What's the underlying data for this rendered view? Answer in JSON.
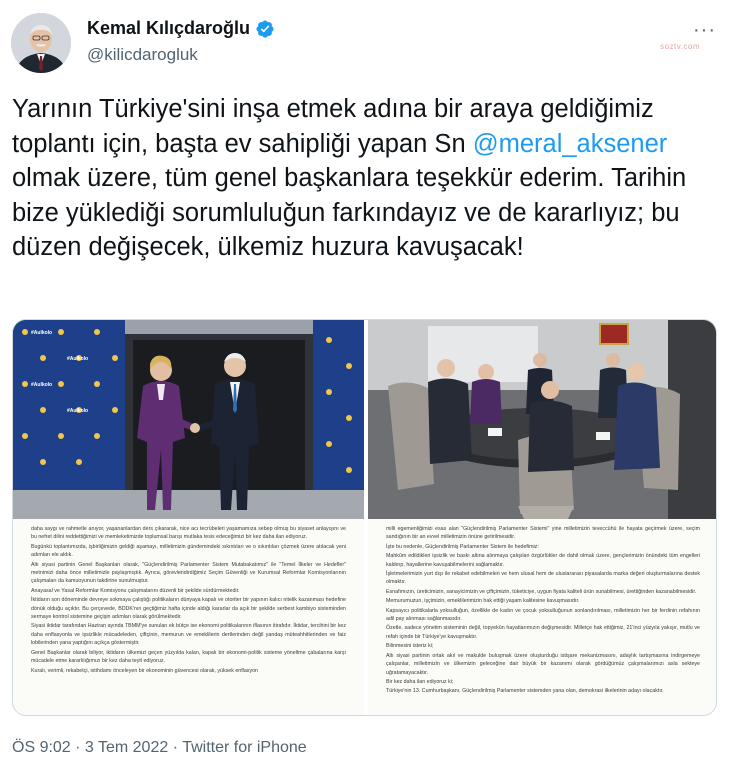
{
  "author": {
    "name": "Kemal Kılıçdaroğlu",
    "handle": "@kilicdarogluk",
    "verified": true
  },
  "watermark": "soztv.com",
  "tweet": {
    "text_before": "Yarının Türkiye'sini inşa etmek adına bir araya geldiğimiz toplantı için, başta ev sahipliği yapan Sn ",
    "mention": "@meral_aksener",
    "text_after": " olmak üzere, tüm genel başkanlara teşekkür ederim. Tarihin bize yüklediği sorumluluğun farkındayız ve de kararlıyız; bu düzen değişecek, ülkemiz huzura kavuşacak!"
  },
  "media": {
    "photo_left": {
      "backdrop_text": "#Aulkolo"
    },
    "doc_left": [
      "daha saygı ve rahmetle anıyor, yaşananlardan ders çıkararak, nice acı tecrübeleri yaşamamıza sebep olmuş bu siyaset anlayışını ve bu nefret dilini reddettiğimizi ve memleketimizde toplumsal barışı mutlaka tesis edeceğimizi bir kez daha ilan ediyoruz.",
      "Bugünkü toplantımızda, işbirliğimizin geldiği aşamayı, milletimizin gündemindeki sıkıntıları ve o sıkıntıları çözmek üzere atılacak yeni adımları ele aldık.",
      "Altı siyasi partinin Genel Başkanları olarak, \"Güçlendirilmiş Parlamenter Sistem Mutabakatımız\" ile \"Temel İlkeler ve Hedefler\" metnimizi daha önce milletimizle paylaşmıştık. Ayrıca, görevlendirdiğimiz Seçim Güvenliği ve Kurumsal Reformlar Komisyonlarının çalışmaları da kamuoyunun takdirine sunulmuştur.",
      "Anayasal ve Yasal Reformlar Komisyonu çalışmalarını düzenli bir şekilde sürdürmektedir.",
      "İktidarın son döneminde devreye sokmaya çalıştığı politikaların dünyaya kapalı ve otoriter bir yapının kalıcı nitelik kazanması hedefine dönük olduğu açıktır. Bu çerçevede, BDDK'nın geçtiğimiz hafta içinde aldığı kararlar da açık bir şekilde serbest kambiyo sisteminden sermaye kontrol sistemine geçişin adımları olarak görülmektedir.",
      "Siyasi iktidar tarafından Haziran ayında TBMM'ye sunulan ek bütçe ise ekonomi politikalarının iflasının itirafıdır. İktidar, tercihini bir kez daha enflasyonla ve işsizlikle mücadeleden, çiftçinin, memurun ve emeklilerin dertlerinden değil yandaş müteahhitlerinden ve faiz lobilerinden yana yaptığını açıkça göstermiştir.",
      "Genel Başkanlar olarak biliyor, iktidarın ülkemizi geçen yüzyılda kalan, kapalı bir ekonomi-politik sisteme yöneltme çabalarına karşı mücadele etme kararlılığımızı bir kez daha teyit ediyoruz.",
      "Kuralı, verimli, rekabetçi, istihdamı önceleyen bir ekonominin güvencesi olarak, yüksek enflasyon"
    ],
    "doc_right": [
      "milli egemenliğimizi esas alan \"Güçlendirilmiş Parlamenter Sistemi\" yine milletimizin teveccühü ile hayata geçirmek üzere, seçim sandığının bir an evvel milletimizin önüne getirilmesidir.",
      "İşte bu nedenle, Güçlendirilmiş Parlamenter Sistem ile hedefimiz:",
      "Mahkûm edildikleri işsizlik ve baskı altına alınmaya çalışılan özgürlükler de dahil olmak üzere, gençlerimizin önündeki tüm engelleri kaldırıp, hayallerine kavuşabilmelerini sağlamaktır.",
      "İşletmelerimizin yurt dışı ile rekabet edebilmeleri ve hem ulusal hem de uluslararası piyasalarda marka değeri oluşturmalarına destek olmaktır.",
      "Esnafımızın, üreticimizin, sanayicimizin ve çiftçimizin, tüketiciye, uygun fiyata kaliteli ürün sunabilmesi, ürettiğinden kazanabilmesidir.",
      "Memurumuzun, işçimizin, emeklilerimizin hak ettiği yaşam kalitesine kavuşmasıdır.",
      "Kapsayıcı politikalarla yoksulluğun, özellikle de kadın ve çocuk yoksulluğunun sonlandırılması, milletimizin her bir ferdinin refahının adil pay alınması sağlanmasıdır.",
      "Özetle, sadece yönetim sisteminin değil, topyekûn hayatlarımızın değişmesidir. Milletçe hak ettiğimiz, 21'inci yüzyıla yakışır, mutlu ve refah içinde bir Türkiye'ye kavuşmaktır.",
      "Bilinmesini isteriz ki;",
      "Altı siyasi partinin ortak akıl ve makulde buluşmak üzere oluşturduğu istişare mekanizmasını, adaylık tartışmasına indirgemeye çalışanlar, milletimizin ve ülkemizin geleceğine dair büyük bir kazanımı olarak gördüğümüz çalışmalarımızı asla sekteye uğratamayacaktır.",
      "Bir kez daha ilan ediyoruz ki;",
      "Türkiye'nin 13. Cumhurbaşkanı, Güçlendirilmiş Parlamenter sistemden yana olan, demokrasi ilkelerinin adayı olacaktır."
    ]
  },
  "footer": {
    "time": "ÖS 9:02",
    "separator1": " · ",
    "date": "3 Tem 2022",
    "separator2": " · ",
    "source": "Twitter for iPhone"
  },
  "colors": {
    "link": "#1d9bf0",
    "text": "#0f1419",
    "secondary": "#536471",
    "backdrop_blue": "#1e3f8a"
  },
  "icons": [
    "verified-badge-icon",
    "more-options-icon"
  ]
}
